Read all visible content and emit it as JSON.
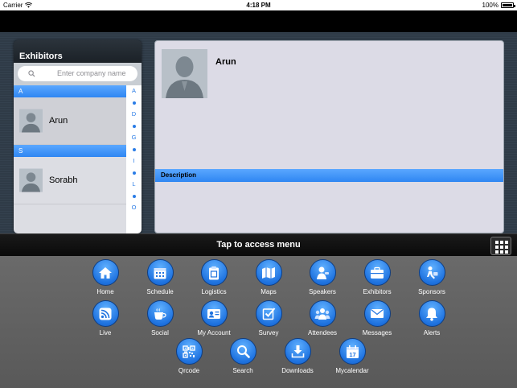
{
  "status_bar": {
    "carrier": "Carrier",
    "time": "4:18 PM",
    "battery": "100%"
  },
  "exhibitors": {
    "title": "Exhibitors",
    "search_placeholder": "Enter company name",
    "sections": [
      {
        "letter": "A",
        "items": [
          {
            "name": "Arun"
          }
        ]
      },
      {
        "letter": "S",
        "items": [
          {
            "name": "Sorabh"
          }
        ]
      }
    ],
    "index": [
      "A",
      "•",
      "D",
      "•",
      "G",
      "•",
      "I",
      "•",
      "L",
      "•",
      "O"
    ]
  },
  "detail": {
    "name": "Arun",
    "description_label": "Description"
  },
  "menu": {
    "caption": "Tap to access menu",
    "items": [
      {
        "label": "Home",
        "icon": "home-icon"
      },
      {
        "label": "Schedule",
        "icon": "calendar-icon"
      },
      {
        "label": "Logistics",
        "icon": "clipboard-icon"
      },
      {
        "label": "Maps",
        "icon": "map-icon"
      },
      {
        "label": "Speakers",
        "icon": "speaker-icon"
      },
      {
        "label": "Exhibitors",
        "icon": "briefcase-icon"
      },
      {
        "label": "Sponsors",
        "icon": "sponsor-icon"
      },
      {
        "label": "Live",
        "icon": "rss-icon"
      },
      {
        "label": "Social",
        "icon": "coffee-icon"
      },
      {
        "label": "My Account",
        "icon": "id-card-icon"
      },
      {
        "label": "Survey",
        "icon": "checkbox-icon"
      },
      {
        "label": "Attendees",
        "icon": "group-icon"
      },
      {
        "label": "Messages",
        "icon": "envelope-icon"
      },
      {
        "label": "Alerts",
        "icon": "bell-icon"
      },
      {
        "label": "Qrcode",
        "icon": "qrcode-icon"
      },
      {
        "label": "Search",
        "icon": "search-icon"
      },
      {
        "label": "Downloads",
        "icon": "download-icon"
      },
      {
        "label": "Mycalendar",
        "icon": "mycalendar-icon",
        "badge": "17"
      }
    ]
  },
  "colors": {
    "accent_blue": "#2f86f2",
    "panel_bg": "#dcdbe6",
    "menu_bg": "#626262"
  }
}
